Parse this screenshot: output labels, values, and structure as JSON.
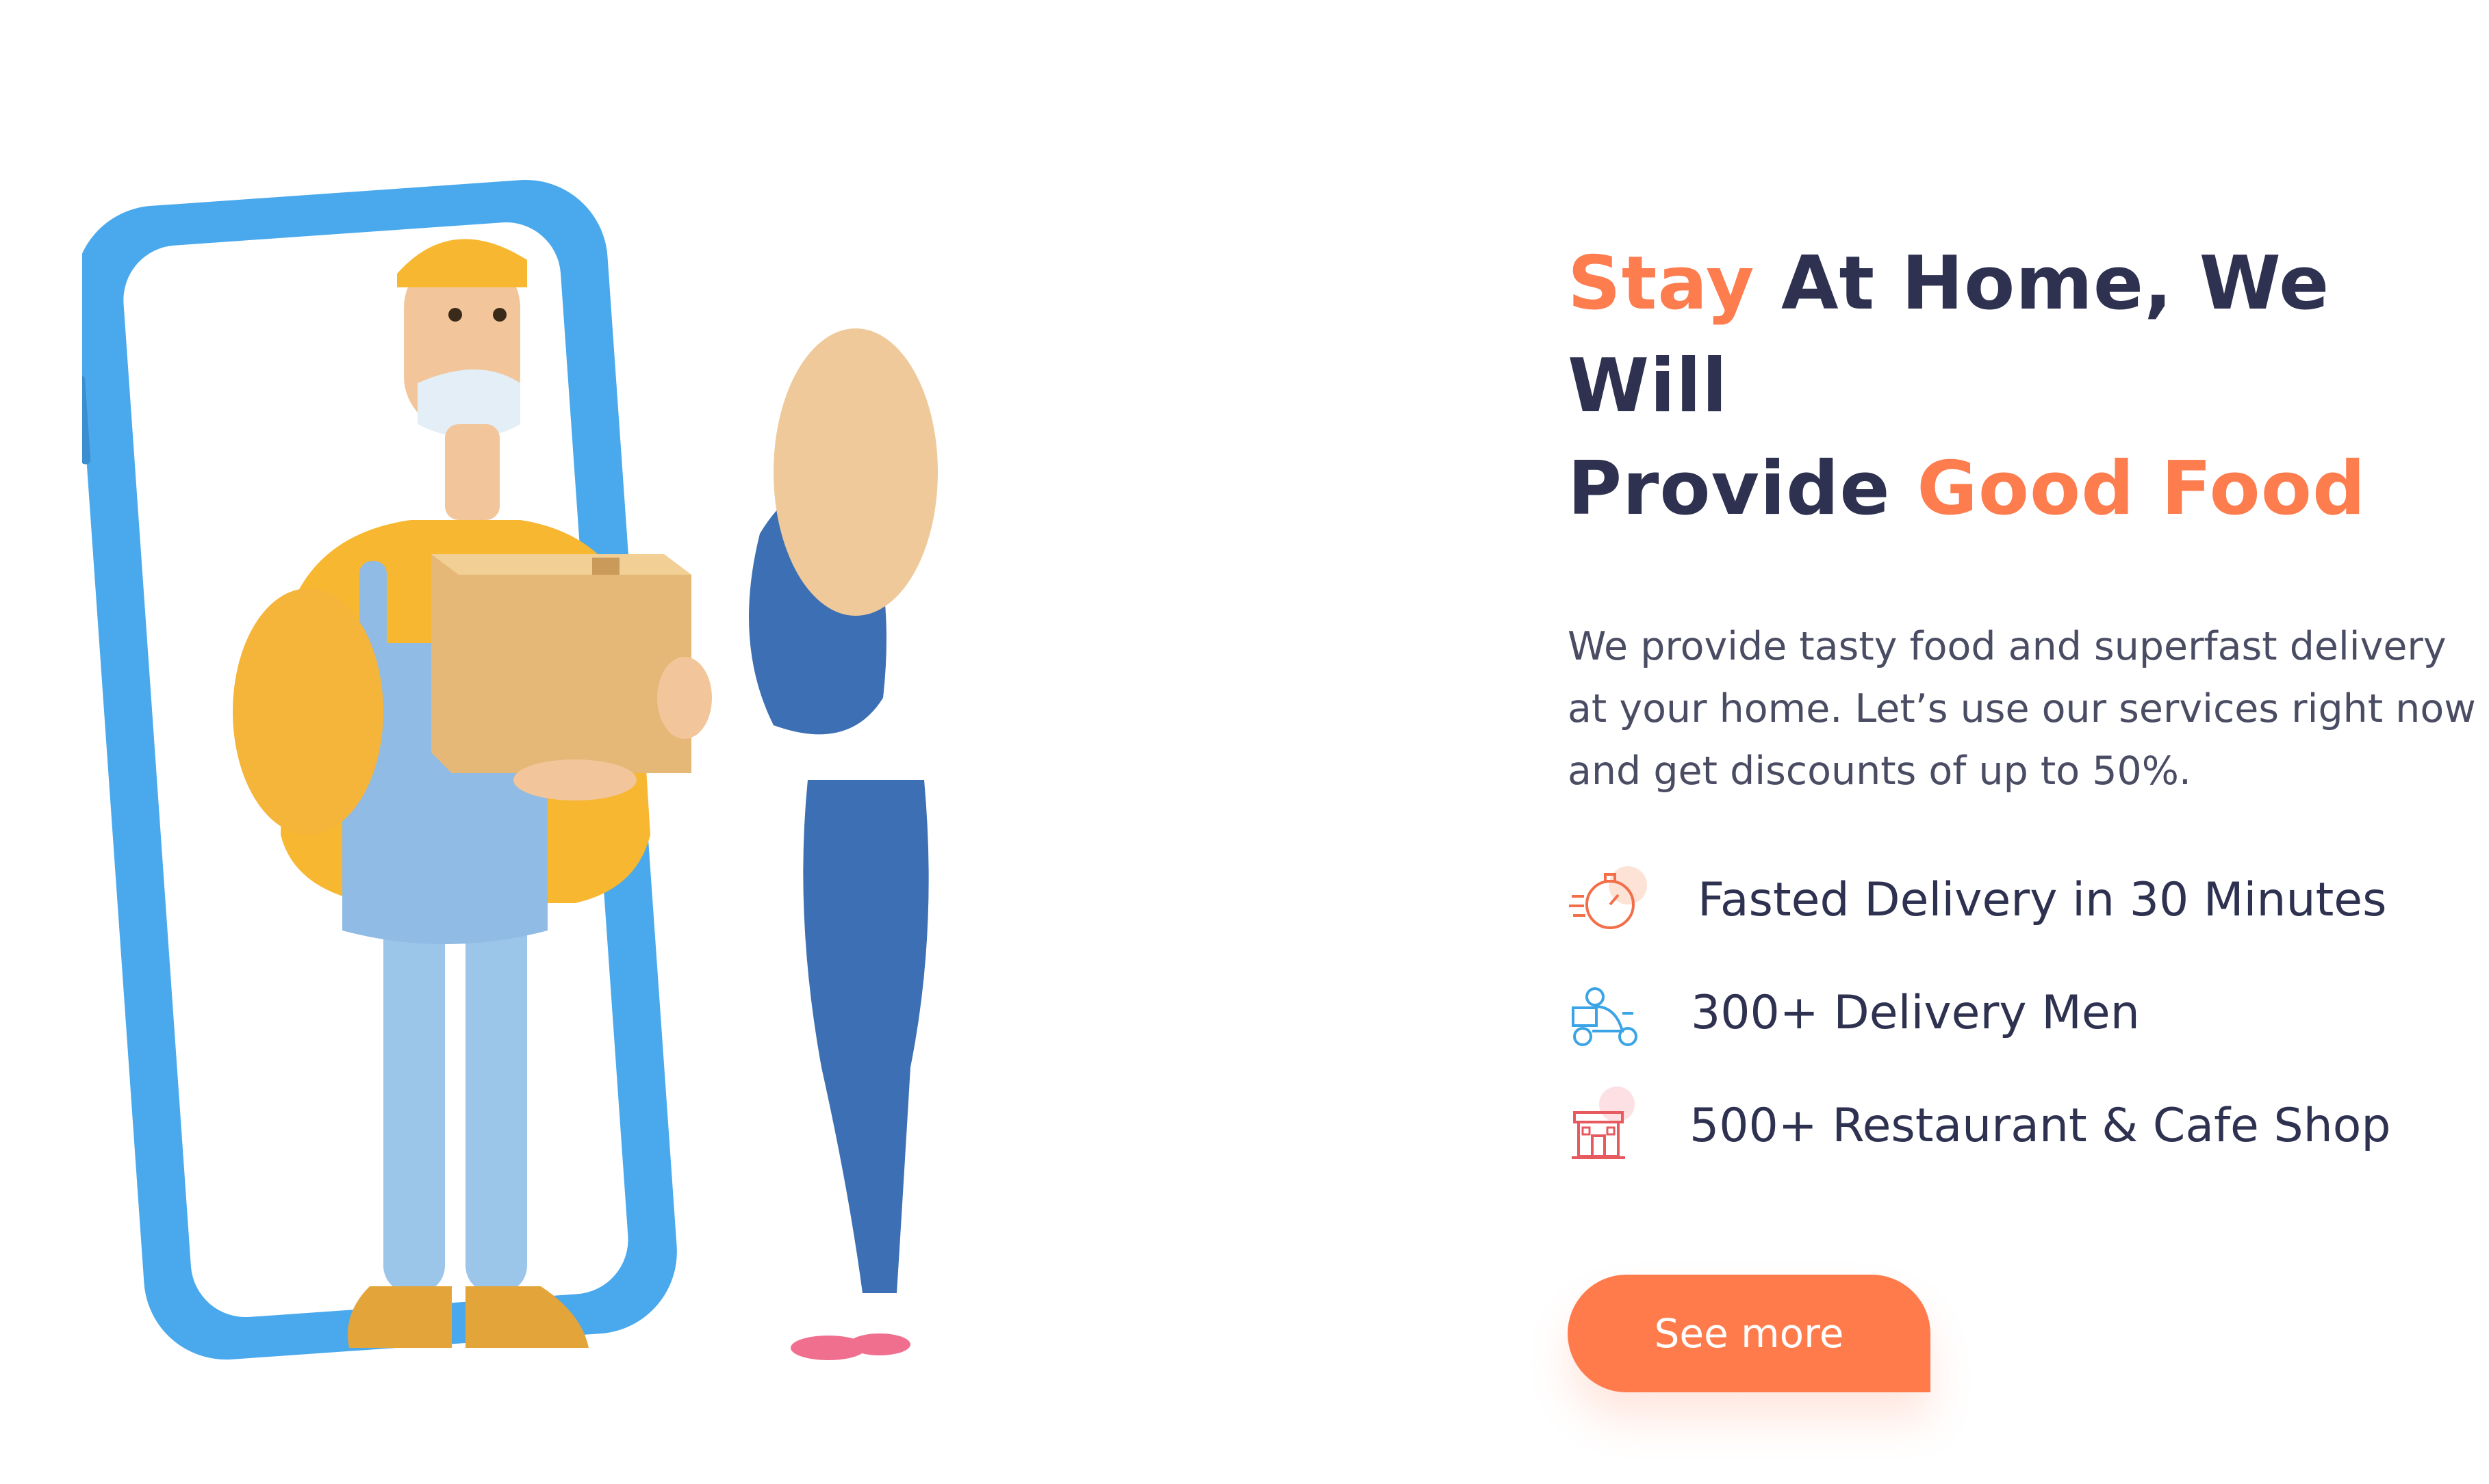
{
  "hero": {
    "illustration_icon": "delivery-man-phone-illustration"
  },
  "headline": {
    "part1": "Stay",
    "part2": " At Home, We Will ",
    "part3": "Provide ",
    "part4": "Good Food"
  },
  "description": "We provide tasty food and superfast delivery at your home.  Let’s use our services right now and get discounts of up to 50%.",
  "features": [
    {
      "icon": "stopwatch-icon",
      "label": "Fasted Delivery in 30 Minutes"
    },
    {
      "icon": "delivery-scooter-icon",
      "label": "300+ Delivery Men"
    },
    {
      "icon": "restaurant-shop-icon",
      "label": "500+ Restaurant & Cafe Shop"
    }
  ],
  "cta": {
    "label": "See more"
  },
  "colors": {
    "accent": "#fd7d4f",
    "heading": "#2e3250",
    "body_text": "#4a4c63",
    "phone_frame": "#4aa9ec",
    "icon_blue": "#3ba4e6",
    "icon_red": "#e65a60"
  }
}
